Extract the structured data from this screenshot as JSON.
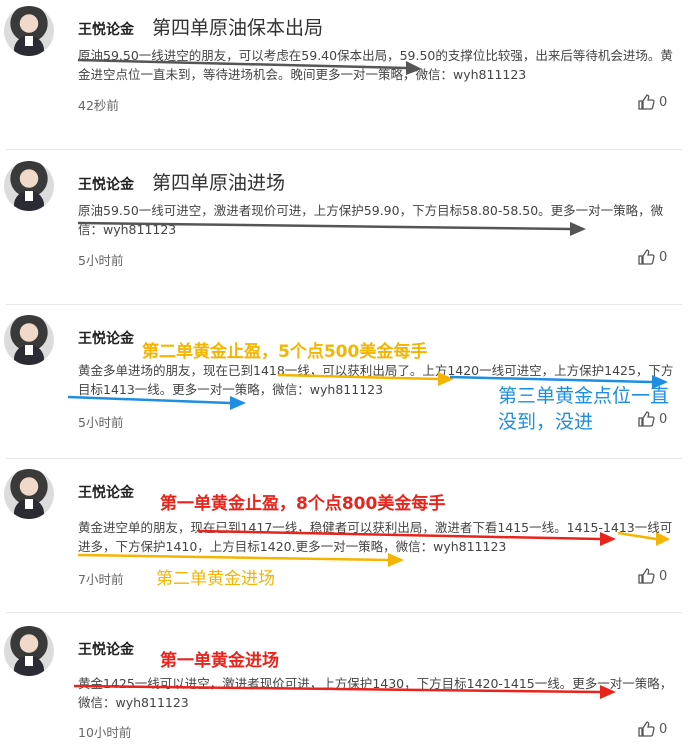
{
  "author": "王悦论金",
  "posts": [
    {
      "title": "第四单原油保本出局",
      "text": "原油59.50一线进空的朋友，可以考虑在59.40保本出局，59.50的支撑位比较强，出来后等待机会进场。黄金进空点位一直未到，等待进场机会。晚间更多一对一策略，微信：wyh811123",
      "time": "42秒前",
      "likes": "0"
    },
    {
      "title": "第四单原油进场",
      "text": "原油59.50一线可进空，激进者现价可进，上方保护59.90，下方目标58.80-58.50。更多一对一策略，微信：wyh811123",
      "time": "5小时前",
      "likes": "0"
    },
    {
      "title": "第二单黄金止盈，5个点500美金每手",
      "text": "黄金多单进场的朋友，现在已到1418一线，可以获利出局了。上方1420一线可进空，上方保护1425，下方目标1413一线。更多一对一策略，微信：wyh811123",
      "time": "5小时前",
      "likes": "0",
      "annotation": "第三单黄金点位一直没到，没进"
    },
    {
      "title": "第一单黄金止盈，8个点800美金每手",
      "text": "黄金进空单的朋友，现在已到1417一线，稳健者可以获利出局，激进者下看1415一线。1415-1413一线可进多，下方保护1410，上方目标1420.更多一对一策略，微信：wyh811123",
      "time": "7小时前",
      "likes": "0",
      "annotation": "第二单黄金进场"
    },
    {
      "title": "第一单黄金进场",
      "text": "黄金1425一线可以进空，激进者现价可进，上方保护1430，下方目标1420-1415一线。更多一对一策略，微信：wyh811123",
      "time": "10小时前",
      "likes": "0"
    }
  ],
  "colors": {
    "red": "#e8241c",
    "gold": "#f4b400",
    "blue": "#1e8ee0",
    "dark_arrow": "#555555"
  }
}
